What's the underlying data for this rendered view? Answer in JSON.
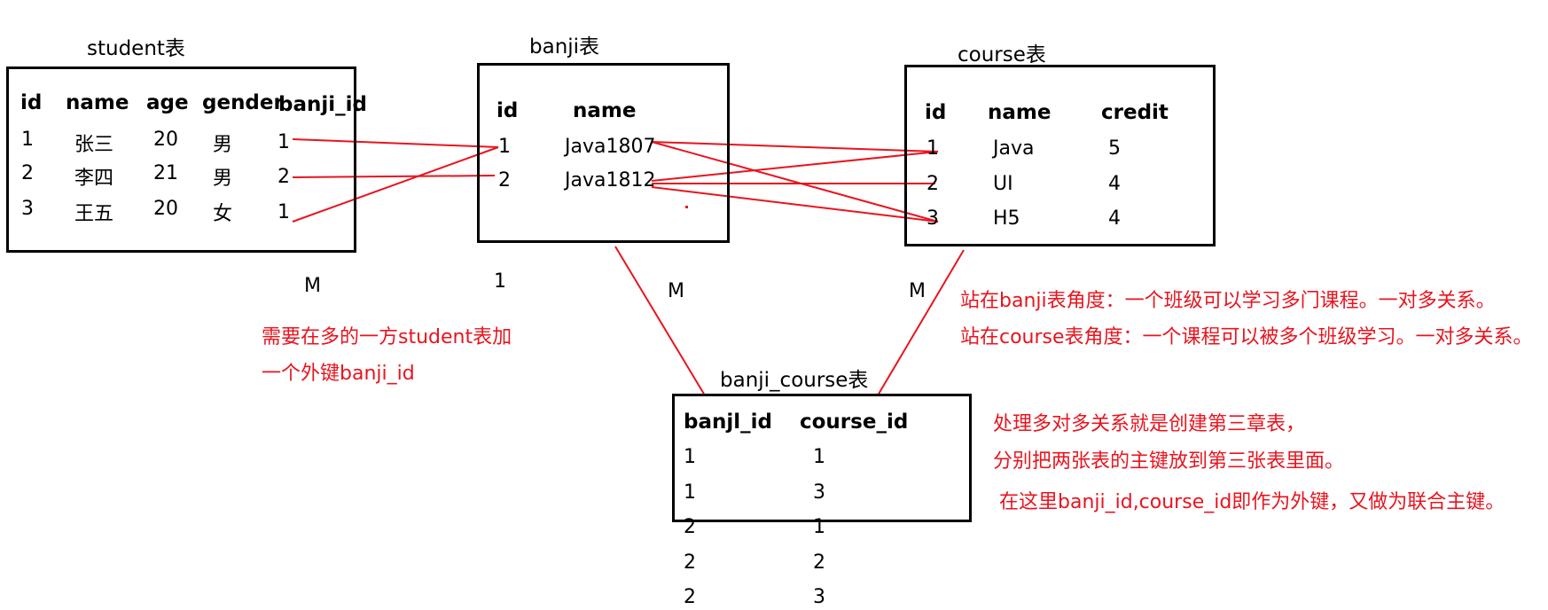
{
  "student": {
    "title": "student表",
    "headers": [
      "id",
      "name",
      "age",
      "gender",
      "banji_id"
    ],
    "rows": [
      [
        "1",
        "张三",
        "20",
        "男",
        "1"
      ],
      [
        "2",
        "李四",
        "21",
        "男",
        "2"
      ],
      [
        "3",
        "王五",
        "20",
        "女",
        "1"
      ]
    ]
  },
  "banji": {
    "title": "banji表",
    "headers": [
      "id",
      "name"
    ],
    "rows": [
      [
        "1",
        "Java1807"
      ],
      [
        "2",
        "Java1812"
      ]
    ]
  },
  "course": {
    "title": "course表",
    "headers": [
      "id",
      "name",
      "credit"
    ],
    "rows": [
      [
        "1",
        "Java",
        "5"
      ],
      [
        "2",
        "UI",
        "4"
      ],
      [
        "3",
        "H5",
        "4"
      ]
    ]
  },
  "banji_course": {
    "title": "banji_course表",
    "headers": [
      "banjl_id",
      "course_id"
    ],
    "rows": [
      [
        "1",
        "1"
      ],
      [
        "1",
        "3"
      ],
      [
        "2",
        "1"
      ],
      [
        "2",
        "2"
      ],
      [
        "2",
        "3"
      ]
    ]
  },
  "cardinality": {
    "student_m": "M",
    "banji_one": "1",
    "banji_course_m_left": "M",
    "banji_course_m_right": "M"
  },
  "notes": {
    "student_note_line1": "需要在多的一方student表加",
    "student_note_line2": "一个外键banji_id",
    "banji_view": "站在banji表角度：一个班级可以学习多门课程。一对多关系。",
    "course_view": "站在course表角度：一个课程可以被多个班级学习。一对多关系。",
    "many_to_many_line1": "处理多对多关系就是创建第三章表，",
    "many_to_many_line2": "分别把两张表的主键放到第三张表里面。",
    "composite_key": "在这里banji_id,course_id即作为外键，又做为联合主键。"
  },
  "colors": {
    "relation_line": "#e8141e",
    "border": "#000000"
  }
}
